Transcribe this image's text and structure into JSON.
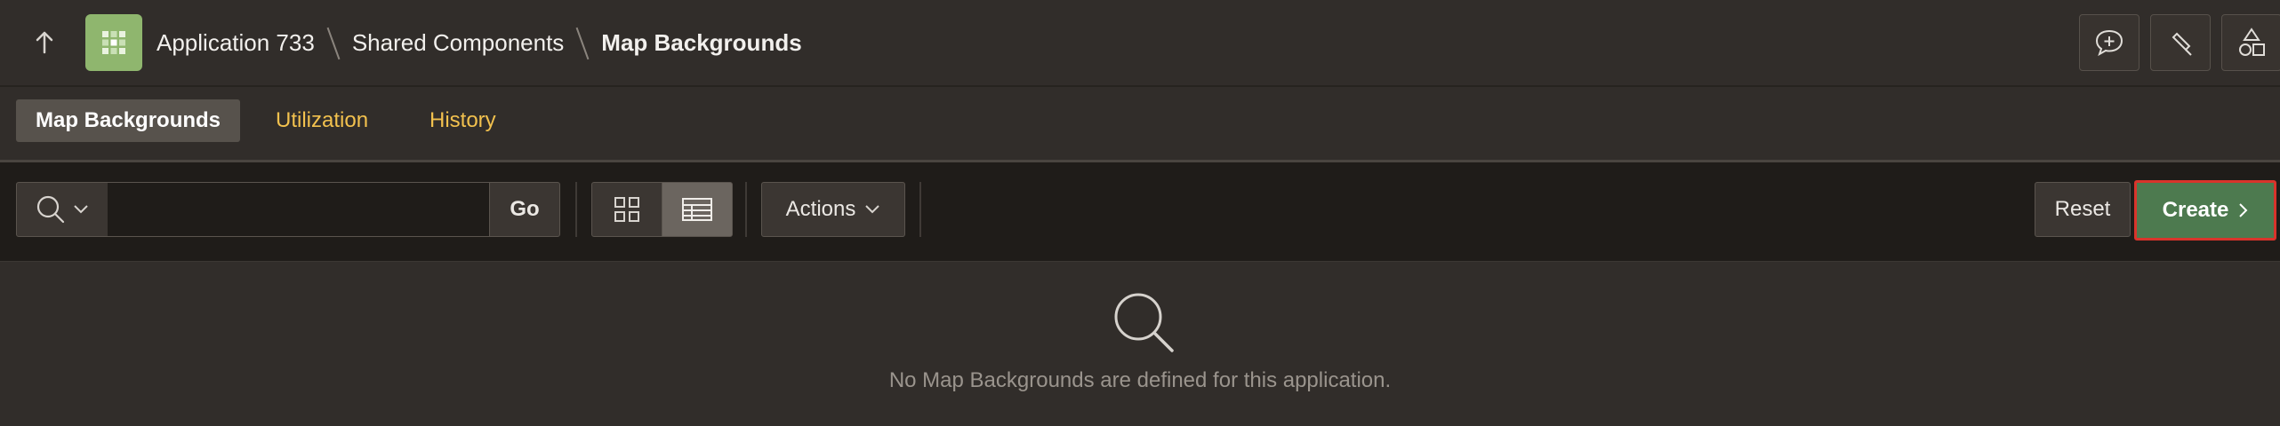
{
  "header": {
    "app_icon": "app-grid-icon",
    "breadcrumb": {
      "app": "Application 733",
      "section": "Shared Components",
      "current": "Map Backgrounds"
    },
    "right_buttons": [
      "comment-add-icon",
      "highlighter-icon",
      "shapes-icon"
    ]
  },
  "tabs": [
    {
      "label": "Map Backgrounds",
      "active": true
    },
    {
      "label": "Utilization",
      "active": false
    },
    {
      "label": "History",
      "active": false
    }
  ],
  "toolbar": {
    "search_value": "",
    "go_label": "Go",
    "actions_label": "Actions",
    "reset_label": "Reset",
    "create_label": "Create"
  },
  "empty_state": {
    "icon": "search-icon",
    "message": "No Map Backgrounds are defined for this application."
  },
  "colors": {
    "header_bg": "#312d2a",
    "toolbar_bg": "#1f1c19",
    "tab_accent": "#f2c14e",
    "create_bg": "#4d7a4f",
    "create_outline": "#d9342b",
    "app_icon_bg": "#8fb66e"
  }
}
